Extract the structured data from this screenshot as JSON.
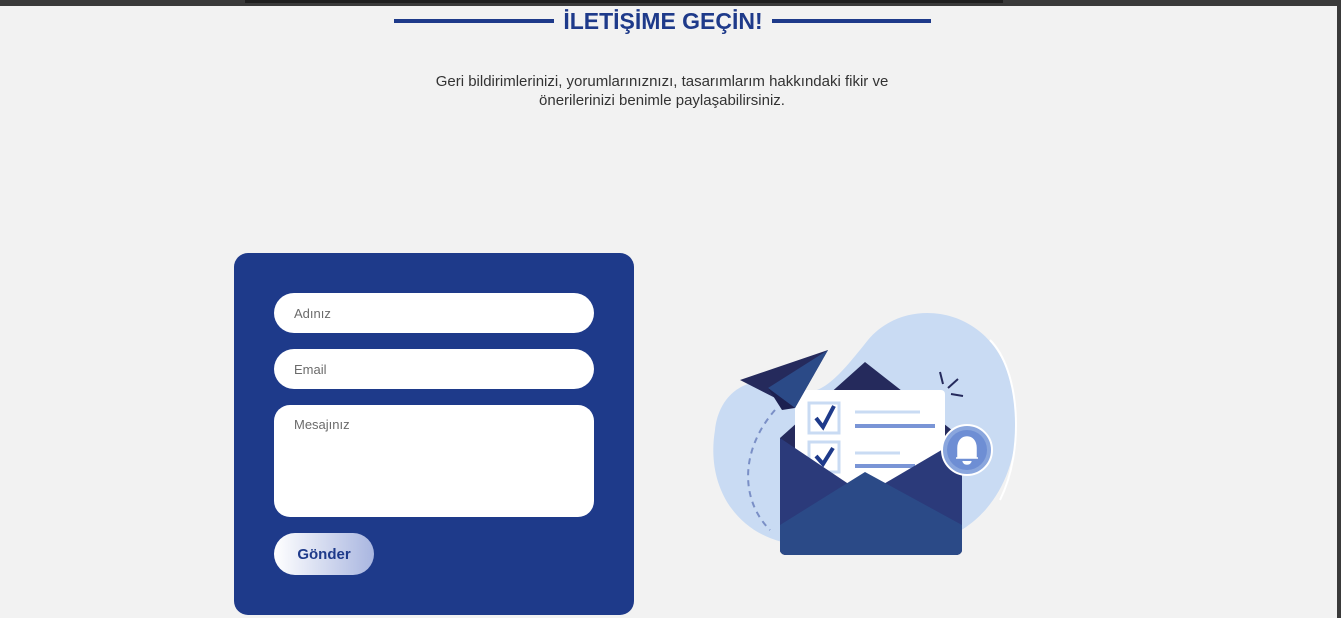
{
  "header": {
    "title": "İLETİŞİME GEÇİN!",
    "subtitle": "Geri bildirimlerinizi, yorumlarınıznızı, tasarımlarım hakkındaki fikir ve önerilerinizi benimle paylaşabilirsiniz."
  },
  "form": {
    "name_placeholder": "Adınız",
    "name_value": "",
    "email_placeholder": "Email",
    "email_value": "",
    "message_placeholder": "Mesajınız",
    "message_value": "",
    "submit_label": "Gönder"
  },
  "illustration": {
    "icon": "envelope-paper-plane-illustration"
  },
  "colors": {
    "primary": "#1e3a8a",
    "page_background": "#f2f2f2",
    "blob": "#c9dbf3",
    "envelope_dark": "#252a5c",
    "envelope_mid": "#2b4a87"
  }
}
